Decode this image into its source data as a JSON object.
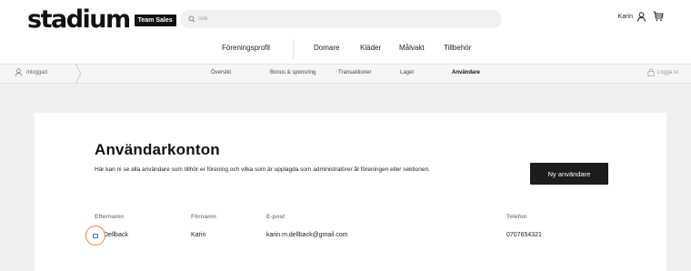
{
  "header": {
    "logo_text": "stadium",
    "logo_badge": "Team Sales",
    "search_placeholder": "Sök",
    "user_name": "Karin",
    "icons": {
      "search": "search-icon",
      "user": "user-icon",
      "cart": "cart-icon"
    }
  },
  "main_nav": {
    "items": [
      "Föreningsprofil",
      "Domare",
      "Kläder",
      "Målvakt",
      "Tillbehör"
    ]
  },
  "sub_nav": {
    "logged_in_label": "Inloggad",
    "items": [
      "Översikt",
      "Bonus & sponsring",
      "Transaktioner",
      "Laget",
      "Användare"
    ],
    "active": "Användare",
    "logout_label": "Logga ut"
  },
  "page": {
    "title": "Användarkonton",
    "description": "Här kan ni se alla användare som tillhör er förening och vilka som är upplagda som administratörer åt föreningen eller sektionen.",
    "new_user_button": "Ny användare"
  },
  "table": {
    "headers": [
      "Efternamn",
      "Förnamn",
      "E-post",
      "Telefon"
    ],
    "rows": [
      {
        "last_name": "Dellback",
        "first_name": "Karin",
        "email": "karin.m.dellback@gmail.com",
        "phone": "0707654321"
      }
    ]
  },
  "colors": {
    "accent_orange": "#e9813a",
    "edit_blue": "#2f6fd0",
    "button_dark": "#1c1c1c"
  }
}
